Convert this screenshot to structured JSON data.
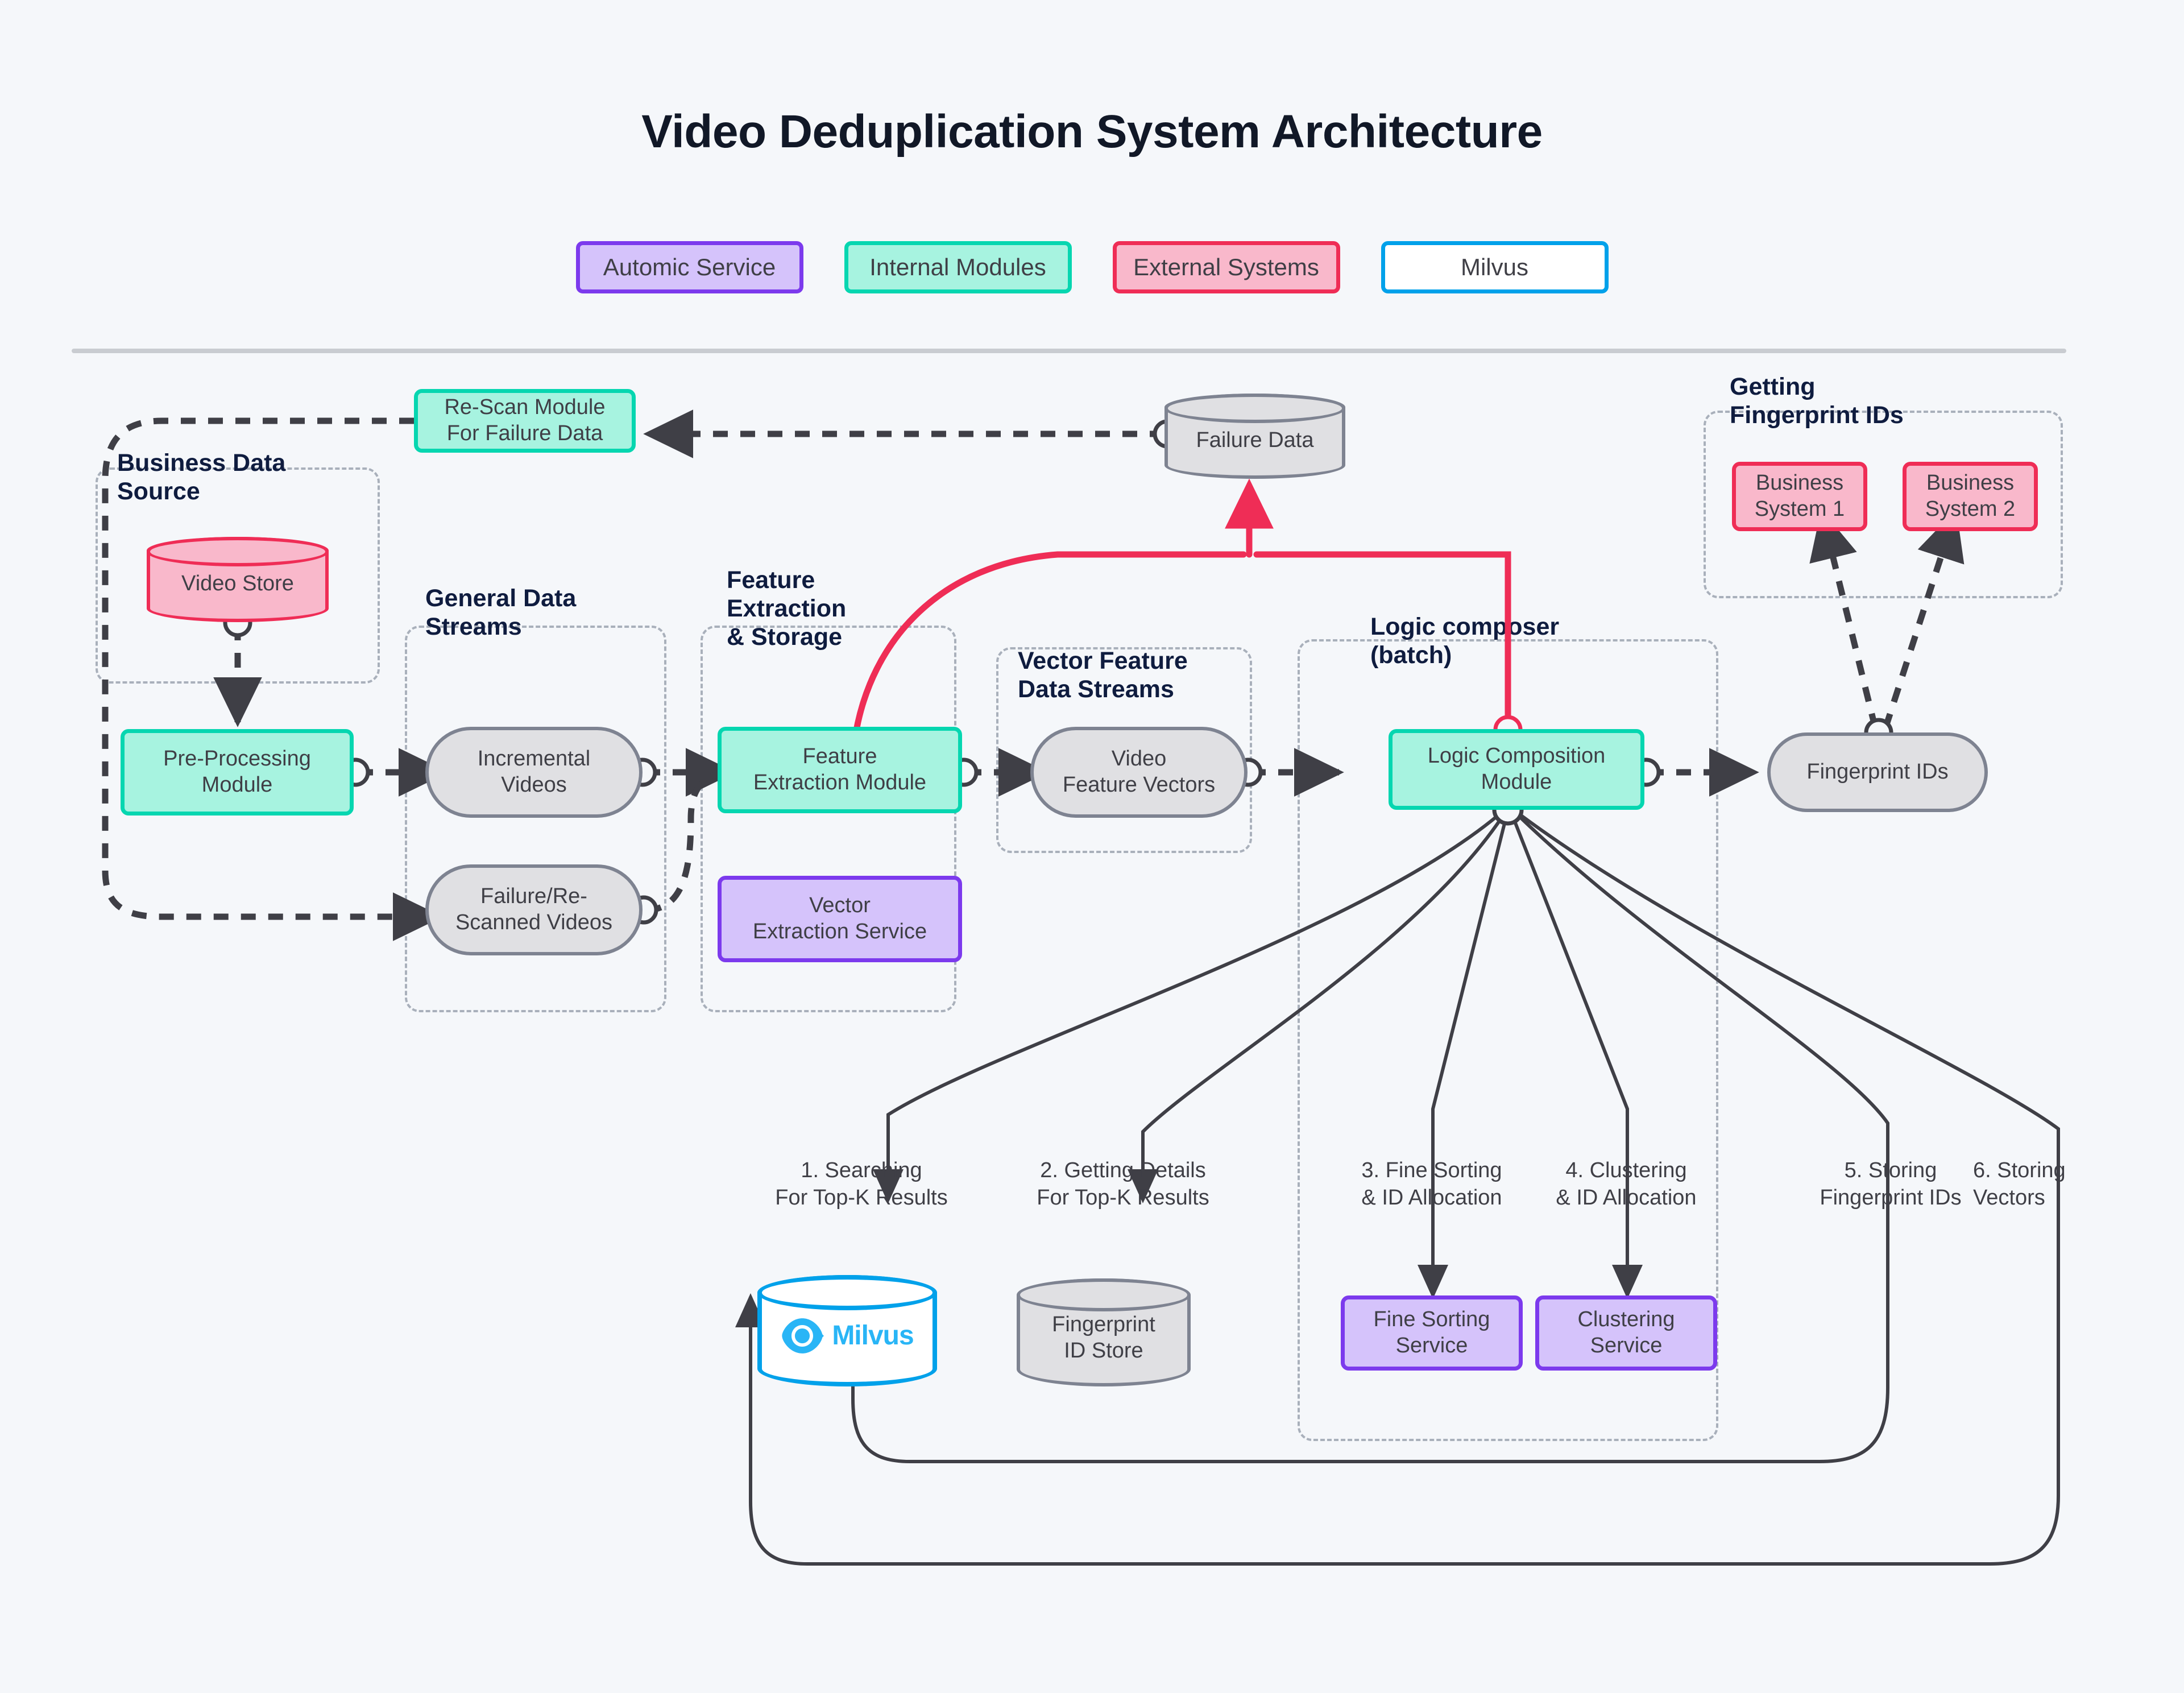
{
  "header": {
    "title": "Video Deduplication System Architecture"
  },
  "legend": {
    "items": [
      {
        "label": "Automic Service",
        "fill": "#d5c3fb",
        "stroke": "#7c3aed"
      },
      {
        "label": "Internal Modules",
        "fill": "#a7f3e0",
        "stroke": "#06d6b0"
      },
      {
        "label": "External Systems",
        "fill": "#f9b8cb",
        "stroke": "#ef2d56"
      },
      {
        "label": "Milvus",
        "fill": "#ffffff",
        "stroke": "#00a1ea"
      }
    ]
  },
  "groups": [
    {
      "id": "business-data-source",
      "title": "Business Data\nSource"
    },
    {
      "id": "general-data-streams",
      "title": "General Data\nStreams"
    },
    {
      "id": "feature-extraction",
      "title": "Feature\nExtraction\n& Storage"
    },
    {
      "id": "vector-feature-streams",
      "title": "Vector Feature\nData Streams"
    },
    {
      "id": "logic-composer",
      "title": "Logic composer\n(batch)"
    },
    {
      "id": "getting-fingerprint-ids",
      "title": "Getting\nFingerprint IDs"
    }
  ],
  "nodes": {
    "rescan_module": {
      "label": "Re-Scan Module\nFor Failure Data"
    },
    "video_store": {
      "label": "Video Store"
    },
    "preprocessing_module": {
      "label": "Pre-Processing\nModule"
    },
    "incremental_videos": {
      "label": "Incremental\nVideos"
    },
    "failure_rescanned": {
      "label": "Failure/Re-\nScanned Videos"
    },
    "feature_extraction_module": {
      "label": "Feature\nExtraction Module"
    },
    "vector_extraction_service": {
      "label": "Vector\nExtraction Service"
    },
    "failure_data": {
      "label": "Failure Data"
    },
    "video_feature_vectors": {
      "label": "Video\nFeature Vectors"
    },
    "logic_composition_module": {
      "label": "Logic Composition\nModule"
    },
    "fingerprint_ids": {
      "label": "Fingerprint IDs"
    },
    "business_system_1": {
      "label": "Business\nSystem 1"
    },
    "business_system_2": {
      "label": "Business\nSystem 2"
    },
    "milvus": {
      "label": "Milvus"
    },
    "fingerprint_id_store": {
      "label": "Fingerprint\nID Store"
    },
    "fine_sorting_service": {
      "label": "Fine Sorting\nService"
    },
    "clustering_service": {
      "label": "Clustering\nService"
    }
  },
  "edge_labels": [
    {
      "id": "flow-1",
      "text": "1. Searching\nFor Top-K Results"
    },
    {
      "id": "flow-2",
      "text": "2. Getting Details\nFor Top-K Results"
    },
    {
      "id": "flow-3",
      "text": "3. Fine Sorting\n& ID Allocation"
    },
    {
      "id": "flow-4",
      "text": "4. Clustering\n& ID Allocation"
    },
    {
      "id": "flow-5",
      "text": "5. Storing\nFingerprint IDs"
    },
    {
      "id": "flow-6",
      "text": "6. Storing\nVectors"
    }
  ],
  "colors": {
    "background": "#f5f7fa",
    "internal_fill": "#a7f3e0",
    "internal_stroke": "#06d6b0",
    "automic_fill": "#d5c3fb",
    "automic_stroke": "#7c3aed",
    "external_fill": "#f9b8cb",
    "external_stroke": "#ef2d56",
    "milvus_stroke": "#00a1ea",
    "store_fill": "#e0e0e3",
    "store_stroke": "#7e8391",
    "group_border": "#a9b0bb",
    "edge_dark": "#3f3f46",
    "edge_red": "#ef2d56",
    "title_color": "#111827"
  }
}
